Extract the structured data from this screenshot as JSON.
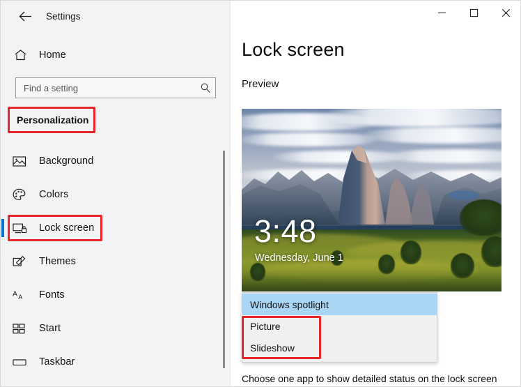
{
  "window": {
    "app_title": "Settings",
    "back_icon": "back-arrow-icon",
    "controls": {
      "minimize": "minimize-icon",
      "maximize": "maximize-icon",
      "close": "close-icon"
    }
  },
  "sidebar": {
    "home": {
      "label": "Home",
      "icon": "home-icon"
    },
    "search": {
      "value": "",
      "placeholder": "Find a setting",
      "icon": "search-icon"
    },
    "category": {
      "label": "Personalization",
      "highlight_color": "#e8262a"
    },
    "selected_item": "Lock screen",
    "selection_accent": "#0078d4",
    "items": [
      {
        "label": "Background",
        "icon": "picture-icon"
      },
      {
        "label": "Colors",
        "icon": "palette-icon"
      },
      {
        "label": "Lock screen",
        "icon": "monitor-lock-icon"
      },
      {
        "label": "Themes",
        "icon": "brush-icon"
      },
      {
        "label": "Fonts",
        "icon": "font-aa-icon"
      },
      {
        "label": "Start",
        "icon": "tiles-icon"
      },
      {
        "label": "Taskbar",
        "icon": "taskbar-icon"
      }
    ]
  },
  "main": {
    "page_title": "Lock screen",
    "preview_label": "Preview",
    "preview": {
      "clock_time": "3:48",
      "clock_date": "Wednesday, June 1"
    },
    "background_dropdown": {
      "selected": "Windows spotlight",
      "highlight_color": "#aad6f5",
      "annotation_color": "#e8262a",
      "options": [
        {
          "label": "Windows spotlight",
          "selected": true,
          "annotated": false
        },
        {
          "label": "Picture",
          "selected": false,
          "annotated": true
        },
        {
          "label": "Slideshow",
          "selected": false,
          "annotated": true
        }
      ]
    },
    "bottom_note": "Choose one app to show detailed status on the lock screen"
  }
}
